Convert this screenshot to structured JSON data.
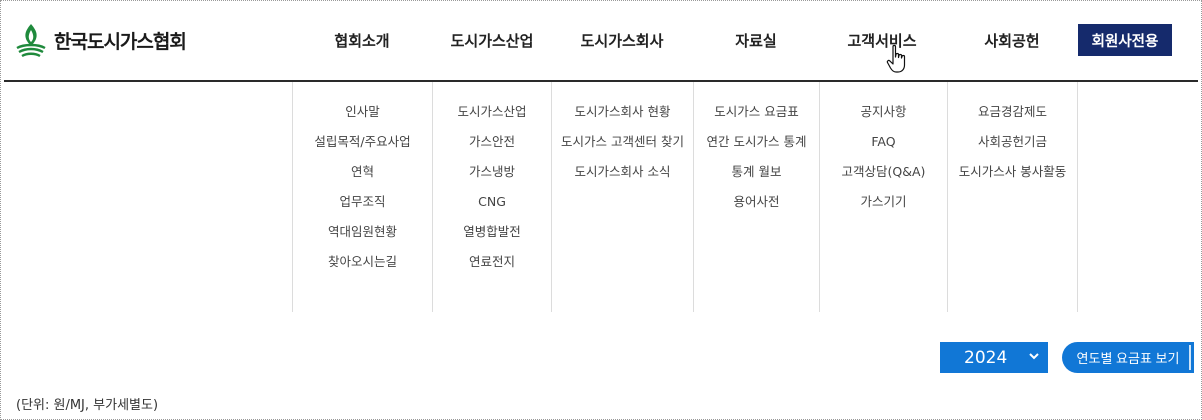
{
  "header": {
    "logo_text": "한국도시가스협회",
    "nav": [
      {
        "label": "협회소개"
      },
      {
        "label": "도시가스산업"
      },
      {
        "label": "도시가스회사"
      },
      {
        "label": "자료실"
      },
      {
        "label": "고객서비스"
      },
      {
        "label": "사회공헌"
      }
    ],
    "member_button": "회원사전용"
  },
  "mega_menu": {
    "columns": [
      {
        "items": [
          "인사말",
          "설립목적/주요사업",
          "연혁",
          "업무조직",
          "역대임원현황",
          "찾아오시는길"
        ]
      },
      {
        "items": [
          "도시가스산업",
          "가스안전",
          "가스냉방",
          "CNG",
          "열병합발전",
          "연료전지"
        ]
      },
      {
        "items": [
          "도시가스회사 현황",
          "도시가스 고객센터 찾기",
          "도시가스회사 소식"
        ]
      },
      {
        "items": [
          "도시가스 요금표",
          "연간 도시가스 통계",
          "통계 월보",
          "용어사전"
        ]
      },
      {
        "items": [
          "공지사항",
          "FAQ",
          "고객상담(Q&A)",
          "가스기기"
        ]
      },
      {
        "items": [
          "요금경감제도",
          "사회공헌기금",
          "도시가스사 봉사활동"
        ]
      }
    ]
  },
  "controls": {
    "year_value": "2024",
    "year_button": "연도별 요금표 보기",
    "unit_note": "(단위: 원/MJ, 부가세별도)"
  },
  "colors": {
    "member_button_bg": "#152a6c",
    "control_blue": "#1177d6",
    "logo_green": "#1f8a3c"
  },
  "icons": {
    "cursor": "hand-pointer-icon",
    "select_arrow": "chevron-down-icon"
  }
}
